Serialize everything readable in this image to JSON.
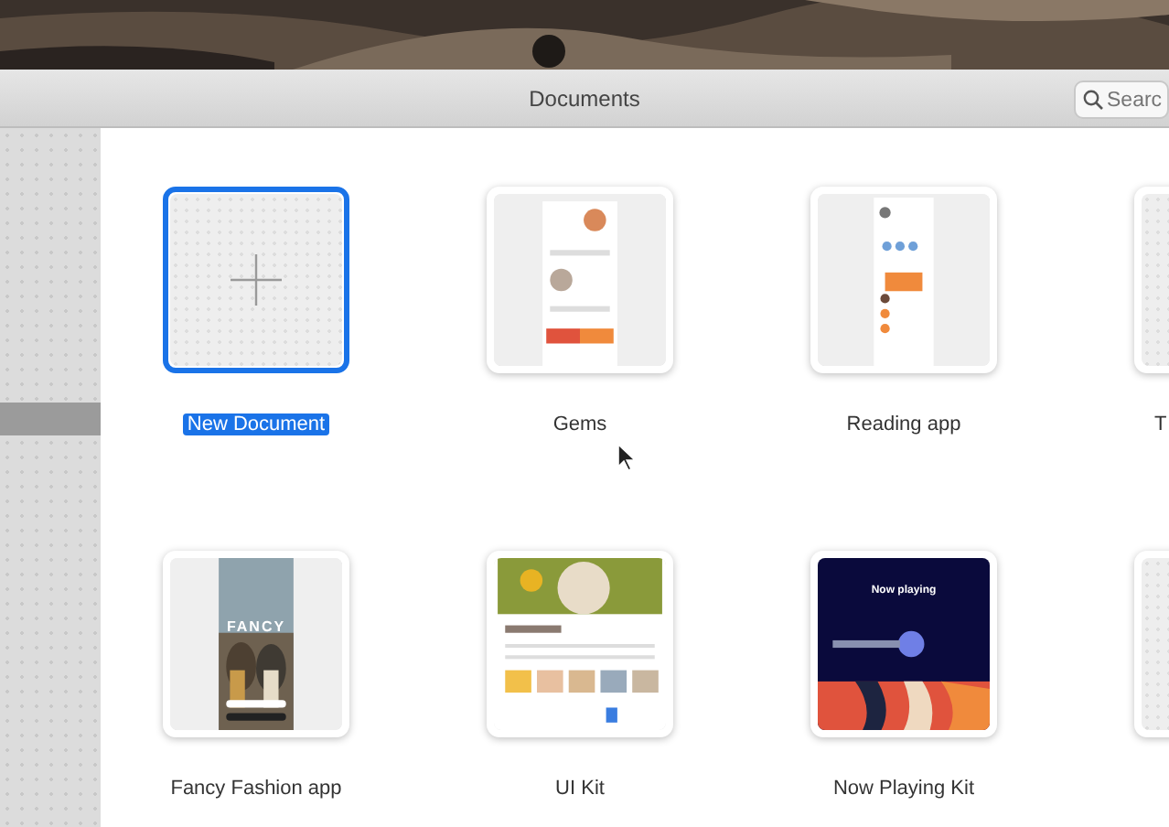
{
  "window": {
    "title": "Documents"
  },
  "search": {
    "placeholder": "Searc"
  },
  "documents": [
    {
      "name": "New Document",
      "kind": "new",
      "selected": true
    },
    {
      "name": "Gems",
      "kind": "web",
      "selected": false
    },
    {
      "name": "Reading app",
      "kind": "mobile",
      "selected": false
    },
    {
      "name": "T",
      "kind": "blank",
      "selected": false,
      "clipped": true
    },
    {
      "name": "Fancy Fashion app",
      "selected": false,
      "preview_title": "FANCY"
    },
    {
      "name": "UI Kit",
      "kind": "gallery",
      "selected": false
    },
    {
      "name": "Now Playing Kit",
      "kind": "player",
      "selected": false,
      "preview_title": "Now playing"
    },
    {
      "kind": "blank",
      "selected": false
    }
  ]
}
